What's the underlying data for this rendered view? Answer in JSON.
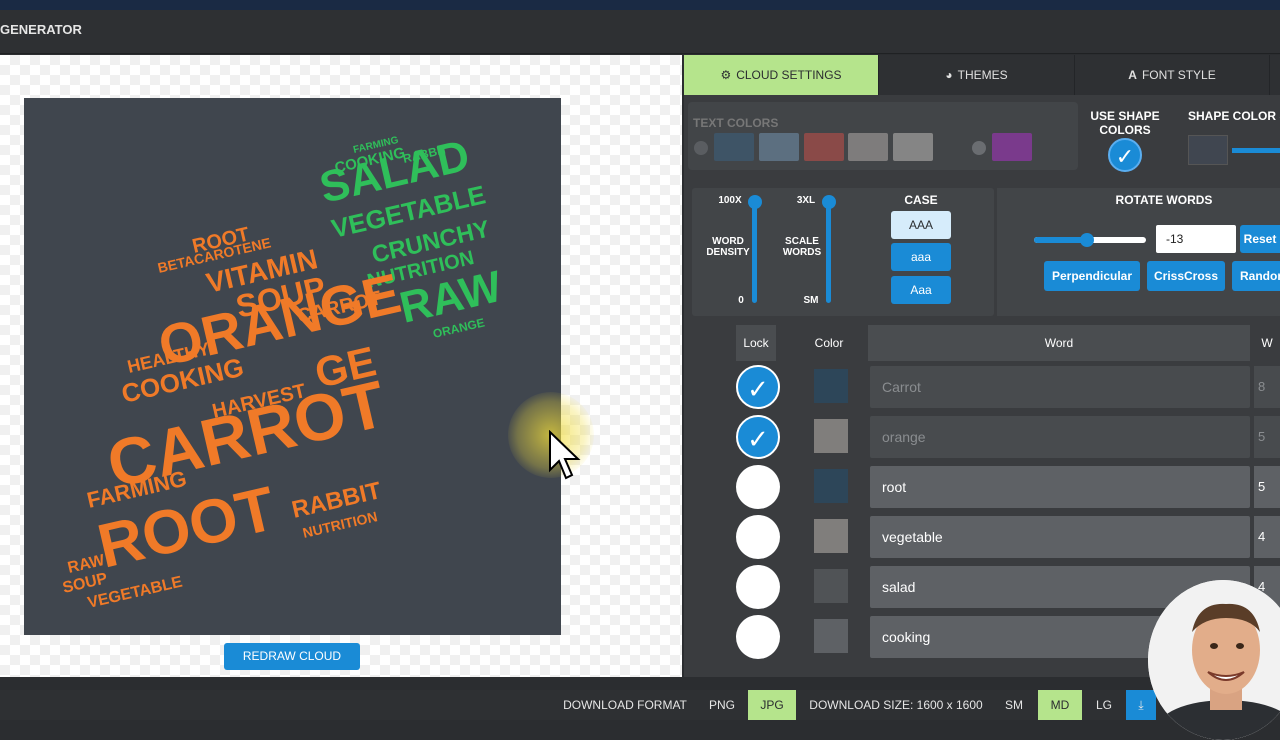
{
  "app": {
    "title": "GENERATOR"
  },
  "tabs": [
    {
      "label": "CLOUD SETTINGS",
      "icon": "gears-icon",
      "active": true
    },
    {
      "label": "THEMES",
      "icon": "palette-icon",
      "active": false
    },
    {
      "label": "FONT STYLE",
      "icon": "font-icon",
      "active": false
    }
  ],
  "text_colors": {
    "label": "TEXT COLORS",
    "swatches": [
      "#3e5466",
      "#5c6f80",
      "#8a4a48",
      "#7e7c7c",
      "#858585"
    ],
    "extra": "#7a3a8c"
  },
  "shape": {
    "use_shape_colors_label": "USE SHAPE COLORS",
    "shape_color_label": "SHAPE COLOR &",
    "shape_color": "#404650"
  },
  "density": {
    "top": "100X",
    "label": "WORD DENSITY",
    "bottom": "0"
  },
  "scale": {
    "top": "3XL",
    "label": "SCALE WORDS",
    "bottom": "SM"
  },
  "case": {
    "label": "CASE",
    "options": [
      "AAA",
      "aaa",
      "Aaa"
    ],
    "selected": "AAA"
  },
  "rotate": {
    "label": "ROTATE WORDS",
    "value": "-13",
    "reset": "Reset",
    "perpendicular": "Perpendicular",
    "crisscross": "CrissCross",
    "random": "Randon"
  },
  "table": {
    "headers": {
      "lock": "Lock",
      "color": "Color",
      "word": "Word",
      "weight": "W"
    },
    "rows": [
      {
        "word": "Carrot",
        "locked": true,
        "color": "#2d4659",
        "weight": "8"
      },
      {
        "word": "orange",
        "locked": true,
        "color": "#807e7c",
        "weight": "5"
      },
      {
        "word": "root",
        "locked": false,
        "color": "#2d4659",
        "weight": "5"
      },
      {
        "word": "vegetable",
        "locked": false,
        "color": "#807e7c",
        "weight": "4"
      },
      {
        "word": "salad",
        "locked": false,
        "color": "#505356",
        "weight": "4"
      },
      {
        "word": "cooking",
        "locked": false,
        "color": "#5e6165",
        "weight": ""
      }
    ]
  },
  "redraw_label": "REDRAW CLOUD",
  "download": {
    "format_label": "DOWNLOAD FORMAT",
    "png": "PNG",
    "jpg": "JPG",
    "size_label": "DOWNLOAD SIZE: 1600 x 1600",
    "sm": "SM",
    "md": "MD",
    "lg": "LG"
  },
  "cloud_words": {
    "salad": "SALAD",
    "vegetable": "VEGETABLE",
    "crunchy": "CRUNCHY",
    "nutrition": "NUTRITION",
    "raw": "RAW",
    "cooking": "COOKING",
    "rabbit": "RABBIT",
    "farming": "FARMING",
    "soup": "SOUP",
    "orange": "ORANGE",
    "root": "ROOT",
    "betacarotene": "BETACAROTENE",
    "vitamin": "VITAMIN",
    "carrot": "CARROT",
    "healthy": "HEALTHY",
    "harvest": "HARVEST"
  }
}
